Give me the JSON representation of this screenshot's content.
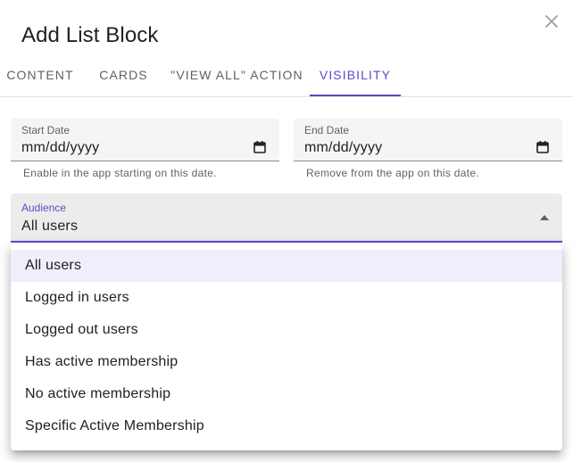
{
  "dialog": {
    "title": "Add List Block",
    "close_icon": "close-icon"
  },
  "tabs": [
    {
      "label": "CONTENT",
      "active": false
    },
    {
      "label": "CARDS",
      "active": false
    },
    {
      "label": "\"VIEW ALL\" ACTION",
      "active": false
    },
    {
      "label": "VISIBILITY",
      "active": true
    }
  ],
  "start_date": {
    "label": "Start Date",
    "value": "mm/dd/yyyy",
    "helper": "Enable in the app starting on this date.",
    "icon": "calendar-icon"
  },
  "end_date": {
    "label": "End Date",
    "value": "mm/dd/yyyy",
    "helper": "Remove from the app on this date.",
    "icon": "calendar-icon"
  },
  "audience": {
    "label": "Audience",
    "value": "All users",
    "icon": "arrow-drop-up-icon",
    "options": [
      "All users",
      "Logged in users",
      "Logged out users",
      "Has active membership",
      "No active membership",
      "Specific Active Membership"
    ]
  },
  "colors": {
    "accent": "#5c4ac7",
    "selected_item_bg": "#f0eefa",
    "field_bg": "#f5f5f5"
  }
}
